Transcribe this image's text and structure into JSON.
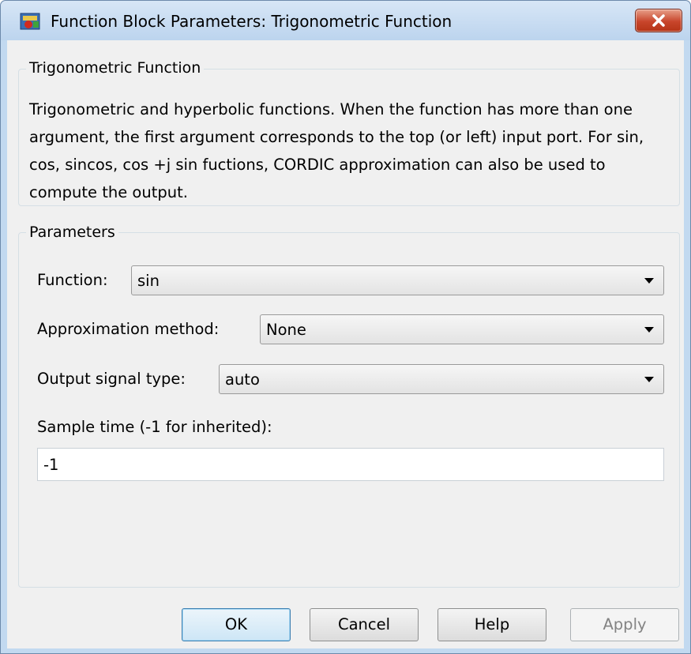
{
  "window": {
    "title": "Function Block Parameters: Trigonometric Function"
  },
  "description_group": {
    "legend": "Trigonometric Function",
    "text": "Trigonometric and hyperbolic functions. When the function has more than one argument, the first argument corresponds to the top (or left) input port. For sin, cos, sincos, cos +j sin fuctions, CORDIC approximation can also be used to compute the output."
  },
  "parameters_group": {
    "legend": "Parameters",
    "function": {
      "label": "Function:",
      "value": "sin"
    },
    "approximation": {
      "label": "Approximation method:",
      "value": "None"
    },
    "output_type": {
      "label": "Output signal type:",
      "value": "auto"
    },
    "sample_time": {
      "label": "Sample time (-1 for inherited):",
      "value": "-1"
    }
  },
  "buttons": {
    "ok": "OK",
    "cancel": "Cancel",
    "help": "Help",
    "apply": "Apply"
  },
  "icons": {
    "app": "simulink-block-icon",
    "close": "close-icon",
    "dropdown": "chevron-down-icon"
  },
  "colors": {
    "titlebar": "#c2d9f0",
    "close_button": "#c8452b",
    "client_background": "#f0f0f0",
    "default_button_border": "#3c7fb1",
    "disabled_text": "#838383"
  }
}
